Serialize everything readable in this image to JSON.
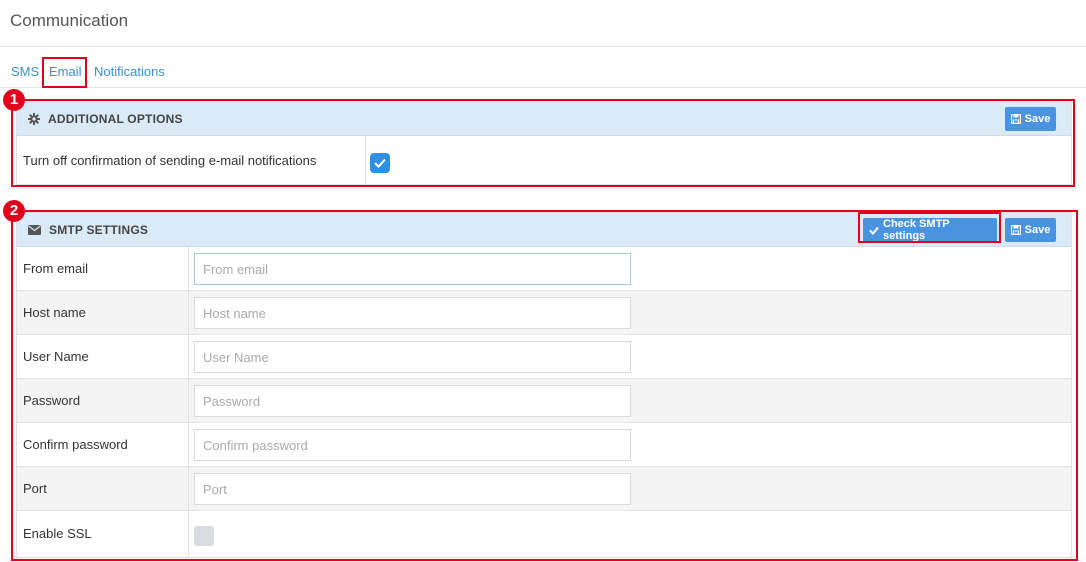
{
  "page": {
    "title": "Communication"
  },
  "tabs": [
    {
      "label": "SMS"
    },
    {
      "label": "Email"
    },
    {
      "label": "Notifications"
    }
  ],
  "annotations": [
    "1",
    "2"
  ],
  "additional_options": {
    "title": "ADDITIONAL OPTIONS",
    "icon": "gear-icon",
    "save_label": "Save",
    "rows": [
      {
        "label": "Turn off confirmation of sending e-mail notifications",
        "checked": true
      }
    ]
  },
  "smtp": {
    "title": "SMTP SETTINGS",
    "icon": "envelope-icon",
    "check_label": "Check SMTP settings",
    "save_label": "Save",
    "fields": [
      {
        "label": "From email",
        "placeholder": "From email",
        "value": ""
      },
      {
        "label": "Host name",
        "placeholder": "Host name",
        "value": ""
      },
      {
        "label": "User Name",
        "placeholder": "User Name",
        "value": ""
      },
      {
        "label": "Password",
        "placeholder": "Password",
        "value": ""
      },
      {
        "label": "Confirm password",
        "placeholder": "Confirm password",
        "value": ""
      },
      {
        "label": "Port",
        "placeholder": "Port",
        "value": ""
      }
    ],
    "ssl": {
      "label": "Enable SSL",
      "checked": false
    }
  },
  "colors": {
    "accent": "#4a93e0",
    "annotation": "#e0001b",
    "panel_header": "#dbeaf7",
    "link": "#3a8fd0"
  }
}
